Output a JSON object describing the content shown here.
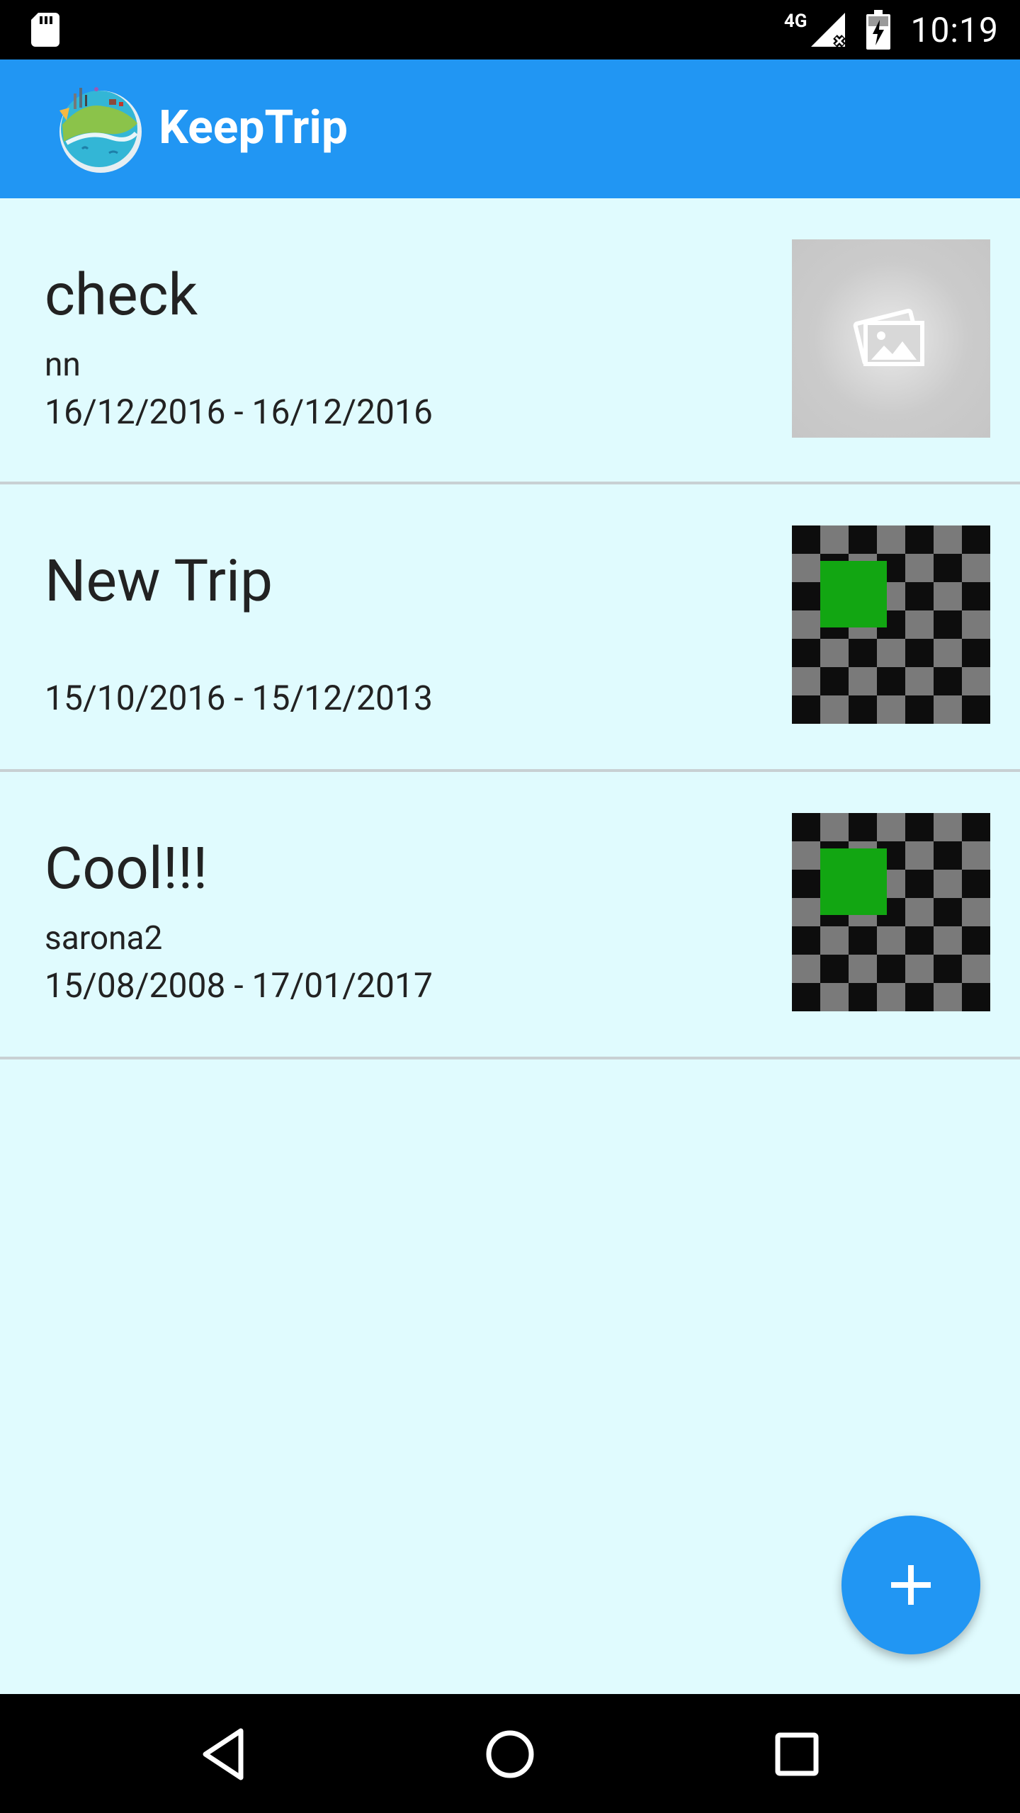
{
  "status_bar": {
    "network": "4G",
    "time": "10:19"
  },
  "app_bar": {
    "title": "KeepTrip",
    "color": "#2196f3"
  },
  "trips": [
    {
      "name": "check",
      "subtitle": "nn",
      "dates": "16/12/2016 - 16/12/2016",
      "thumbnail": "placeholder-image-icon"
    },
    {
      "name": "New Trip",
      "subtitle": "",
      "dates": "15/10/2016 - 15/12/2013",
      "thumbnail": "checker-photo"
    },
    {
      "name": "Cool!!!",
      "subtitle": "sarona2",
      "dates": "15/08/2008 - 17/01/2017",
      "thumbnail": "checker-photo"
    }
  ],
  "fab": {
    "icon": "plus-icon"
  },
  "nav_bar": {
    "icons": [
      "back-icon",
      "home-icon",
      "recents-icon"
    ]
  }
}
